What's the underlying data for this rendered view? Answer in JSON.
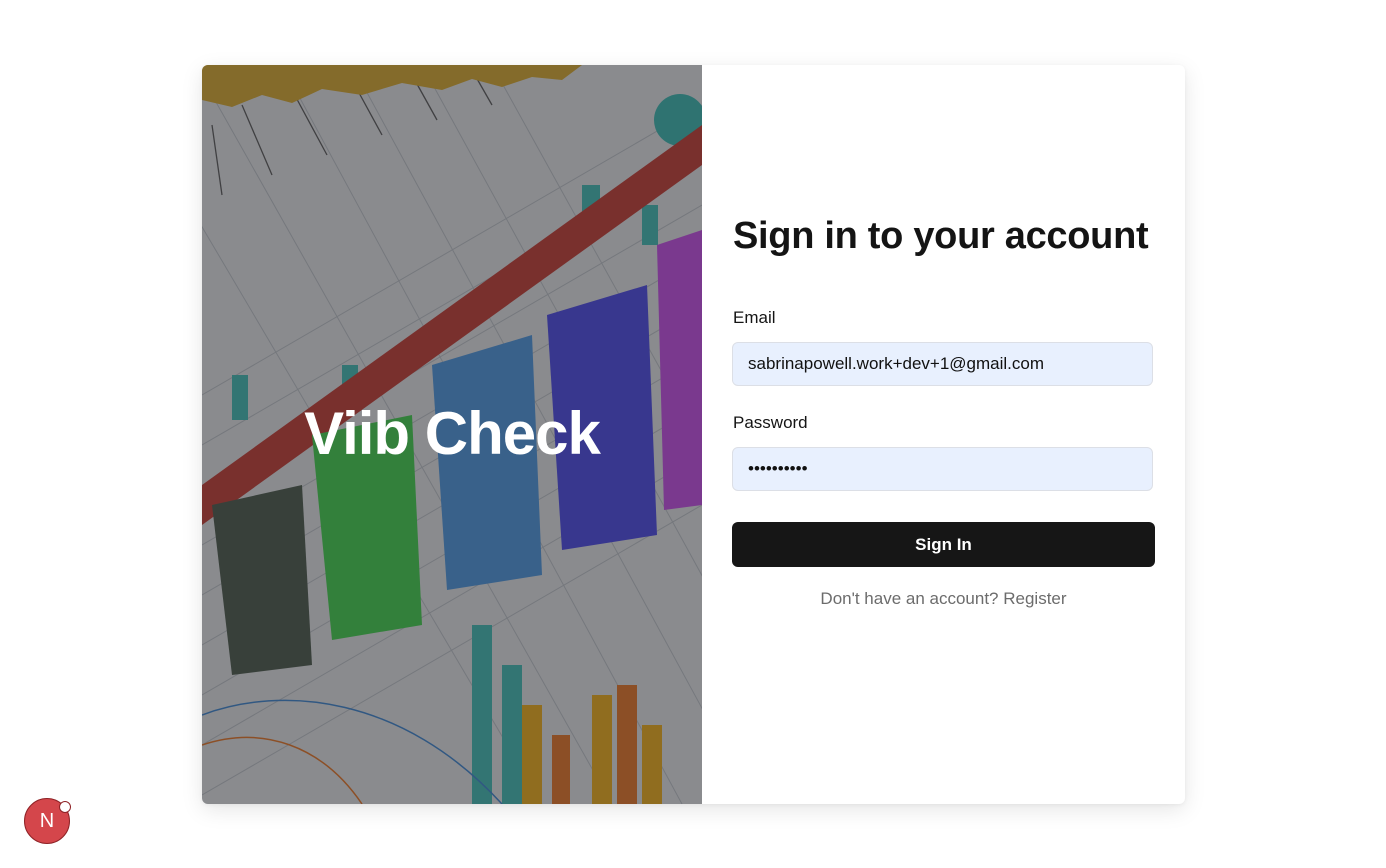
{
  "hero": {
    "title": "Viib Check",
    "background": "stock-charts-photo"
  },
  "form": {
    "title": "Sign in to your account",
    "email": {
      "label": "Email",
      "value": "sabrinapowell.work+dev+1@gmail.com"
    },
    "password": {
      "label": "Password",
      "value": "••••••••••"
    },
    "submit_label": "Sign In",
    "register_prompt": "Don't have an account?",
    "register_link": "Register"
  },
  "dev_badge": {
    "letter": "N",
    "icon": "nextjs-icon"
  },
  "colors": {
    "input_background": "#e8f0fe",
    "button_background": "#161616",
    "badge_background": "#d4464b",
    "muted_text": "#6c6c6c"
  }
}
